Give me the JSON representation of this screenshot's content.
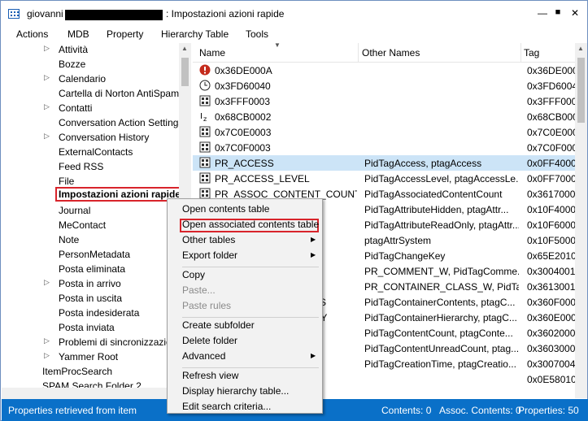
{
  "window": {
    "user": "giovanni",
    "title": ": Impostazioni azioni rapide",
    "minimize": "—",
    "maximize": "■",
    "close": "✕"
  },
  "menu": [
    "Actions",
    "MDB",
    "Property",
    "Hierarchy Table",
    "Tools"
  ],
  "tree": [
    {
      "label": "Attività",
      "expander": true
    },
    {
      "label": "Bozze",
      "expander": false
    },
    {
      "label": "Calendario",
      "expander": true
    },
    {
      "label": "Cartella di Norton AntiSpam",
      "expander": false
    },
    {
      "label": "Contatti",
      "expander": true
    },
    {
      "label": "Conversation Action Settings",
      "expander": false
    },
    {
      "label": "Conversation History",
      "expander": true
    },
    {
      "label": "ExternalContacts",
      "expander": false
    },
    {
      "label": "Feed RSS",
      "expander": false
    },
    {
      "label": "File",
      "expander": false
    },
    {
      "label": "Impostazioni azioni rapide",
      "expander": false,
      "selected": true
    },
    {
      "label": "Journal",
      "expander": false
    },
    {
      "label": "MeContact",
      "expander": false
    },
    {
      "label": "Note",
      "expander": false
    },
    {
      "label": "PersonMetadata",
      "expander": false
    },
    {
      "label": "Posta eliminata",
      "expander": false
    },
    {
      "label": "Posta in arrivo",
      "expander": true
    },
    {
      "label": "Posta in uscita",
      "expander": false
    },
    {
      "label": "Posta indesiderata",
      "expander": false
    },
    {
      "label": "Posta inviata",
      "expander": false
    },
    {
      "label": "Problemi di sincronizzazione",
      "expander": true
    },
    {
      "label": "Yammer Root",
      "expander": true
    },
    {
      "label": "ItemProcSearch",
      "expander": false,
      "root": true
    },
    {
      "label": "SPAM Search Folder 2",
      "expander": false,
      "root": true
    }
  ],
  "table": {
    "headers": {
      "name": "Name",
      "other": "Other Names",
      "tag": "Tag"
    },
    "rows": [
      {
        "icon": "error-icon",
        "name": "0x36DE000A",
        "other": "",
        "tag": "0x36DE000"
      },
      {
        "icon": "clock-icon",
        "name": "0x3FD60040",
        "other": "",
        "tag": "0x3FD6004"
      },
      {
        "icon": "binary-icon",
        "name": "0x3FFF0003",
        "other": "",
        "tag": "0x3FFF000"
      },
      {
        "icon": "text-icon",
        "name": "0x68CB0002",
        "other": "",
        "tag": "0x68CB000"
      },
      {
        "icon": "binary-icon",
        "name": "0x7C0E0003",
        "other": "",
        "tag": "0x7C0E000"
      },
      {
        "icon": "binary-icon",
        "name": "0x7C0F0003",
        "other": "",
        "tag": "0x7C0F000"
      },
      {
        "icon": "binary-icon",
        "name": "PR_ACCESS",
        "other": "PidTagAccess, ptagAccess",
        "tag": "0x0FF4000",
        "selected": true
      },
      {
        "icon": "binary-icon",
        "name": "PR_ACCESS_LEVEL",
        "other": "PidTagAccessLevel, ptagAccessLe...",
        "tag": "0x0FF7000"
      },
      {
        "icon": "binary-icon",
        "name": "PR_ASSOC_CONTENT_COUNT",
        "other": "PidTagAssociatedContentCount",
        "tag": "0x3617000"
      },
      {
        "icon": "",
        "name": "",
        "other": "PidTagAttributeHidden, ptagAttr...",
        "tag": "0x10F4000"
      },
      {
        "icon": "",
        "name": "",
        "other": "PidTagAttributeReadOnly, ptagAttr...",
        "tag": "0x10F6000"
      },
      {
        "icon": "",
        "name": "",
        "other": "ptagAttrSystem",
        "tag": "0x10F5000"
      },
      {
        "icon": "",
        "name": "",
        "other": "PidTagChangeKey",
        "tag": "0x65E2010"
      },
      {
        "icon": "",
        "name": "",
        "other": "PR_COMMENT_W, PidTagComme...",
        "tag": "0x3004001"
      },
      {
        "icon": "",
        "name": "",
        "other": "PR_CONTAINER_CLASS_W, PidTag...",
        "tag": "0x3613001"
      },
      {
        "icon": "",
        "name": "NTS",
        "other": "PidTagContainerContents, ptagC...",
        "tag": "0x360F000"
      },
      {
        "icon": "",
        "name": "CHY",
        "other": "PidTagContainerHierarchy, ptagC...",
        "tag": "0x360E000"
      },
      {
        "icon": "",
        "name": "",
        "other": "PidTagContentCount, ptagConte...",
        "tag": "0x3602000"
      },
      {
        "icon": "",
        "name": "",
        "other": "PidTagContentUnreadCount, ptag...",
        "tag": "0x3603000"
      },
      {
        "icon": "",
        "name": "",
        "other": "PidTagCreationTime, ptagCreatio...",
        "tag": "0x3007004"
      },
      {
        "icon": "",
        "name": "",
        "other": "",
        "tag": "0x0E58010"
      }
    ]
  },
  "context_menu": {
    "items": [
      {
        "label": "Open contents table",
        "disabled": false
      },
      {
        "label": "Open associated contents table",
        "disabled": false,
        "highlighted": true
      },
      {
        "label": "Other tables",
        "disabled": false,
        "submenu": true
      },
      {
        "label": "Export folder",
        "disabled": false,
        "submenu": true
      },
      {
        "sep": true
      },
      {
        "label": "Copy",
        "disabled": false
      },
      {
        "label": "Paste...",
        "disabled": true
      },
      {
        "label": "Paste rules",
        "disabled": true
      },
      {
        "sep": true
      },
      {
        "label": "Create subfolder",
        "disabled": false
      },
      {
        "label": "Delete folder",
        "disabled": false
      },
      {
        "label": "Advanced",
        "disabled": false,
        "submenu": true
      },
      {
        "sep": true
      },
      {
        "label": "Refresh view",
        "disabled": false
      },
      {
        "label": "Display hierarchy table...",
        "disabled": false
      },
      {
        "label": "Edit search criteria...",
        "disabled": false
      }
    ]
  },
  "status": {
    "left": "Properties retrieved from item",
    "contents": "Contents: 0",
    "assoc": "Assoc. Contents: 0",
    "properties": "Properties: 50"
  },
  "colors": {
    "accent": "#0a70c8",
    "highlight": "#d8242b",
    "selection": "#cce4f7"
  }
}
